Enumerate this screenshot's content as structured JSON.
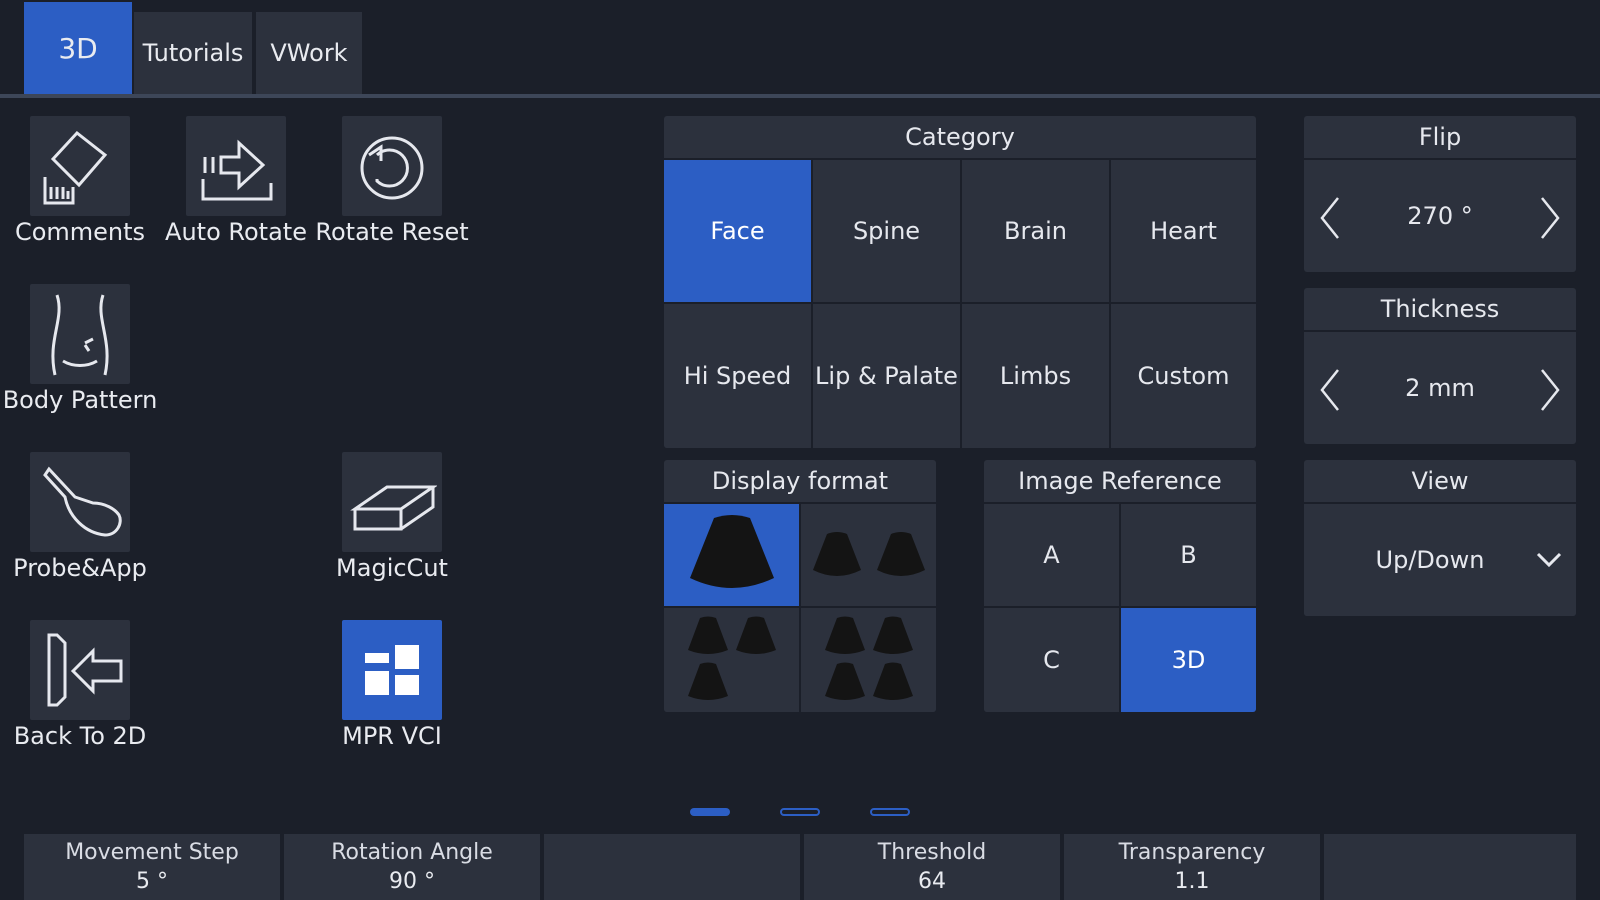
{
  "tabs": [
    {
      "label": "3D",
      "active": true
    },
    {
      "label": "Tutorials",
      "active": false
    },
    {
      "label": "VWork",
      "active": false
    }
  ],
  "tools": {
    "comments": {
      "label": "Comments",
      "icon": "comments-icon"
    },
    "auto_rotate": {
      "label": "Auto Rotate",
      "icon": "auto-rotate-icon"
    },
    "rotate_reset": {
      "label": "Rotate Reset",
      "icon": "rotate-reset-icon"
    },
    "body_pattern": {
      "label": "Body Pattern",
      "icon": "body-pattern-icon"
    },
    "probe_app": {
      "label": "Probe&App",
      "icon": "probe-icon"
    },
    "magic_cut": {
      "label": "MagicCut",
      "icon": "magiccut-icon"
    },
    "back_to_2d": {
      "label": "Back To 2D",
      "icon": "back-arrow-icon"
    },
    "mpr_vci": {
      "label": "MPR VCI",
      "icon": "mpr-vci-icon"
    }
  },
  "category": {
    "title": "Category",
    "items": [
      {
        "label": "Face",
        "active": true
      },
      {
        "label": "Spine",
        "active": false
      },
      {
        "label": "Brain",
        "active": false
      },
      {
        "label": "Heart",
        "active": false
      },
      {
        "label": "Hi Speed",
        "active": false
      },
      {
        "label": "Lip & Palate",
        "active": false
      },
      {
        "label": "Limbs",
        "active": false
      },
      {
        "label": "Custom",
        "active": false
      }
    ]
  },
  "flip": {
    "title": "Flip",
    "value": "270 °"
  },
  "thickness": {
    "title": "Thickness",
    "value": "2 mm"
  },
  "view": {
    "title": "View",
    "value": "Up/Down"
  },
  "display_format": {
    "title": "Display format",
    "options": [
      "1x1",
      "1x2",
      "2+1",
      "2x2"
    ],
    "selected": "1x1"
  },
  "image_reference": {
    "title": "Image Reference",
    "items": [
      {
        "label": "A",
        "active": false
      },
      {
        "label": "B",
        "active": false
      },
      {
        "label": "C",
        "active": false
      },
      {
        "label": "3D",
        "active": true
      }
    ]
  },
  "page_indicator": {
    "pages": 3,
    "current": 1
  },
  "params": [
    {
      "name": "Movement Step",
      "value": "5 °"
    },
    {
      "name": "Rotation Angle",
      "value": "90 °"
    },
    {
      "name": "",
      "value": ""
    },
    {
      "name": "Threshold",
      "value": "64"
    },
    {
      "name": "Transparency",
      "value": "1.1"
    },
    {
      "name": "",
      "value": ""
    }
  ],
  "colors": {
    "accent": "#2c5ec4",
    "panel": "#2c313d",
    "background": "#1b1f29"
  }
}
